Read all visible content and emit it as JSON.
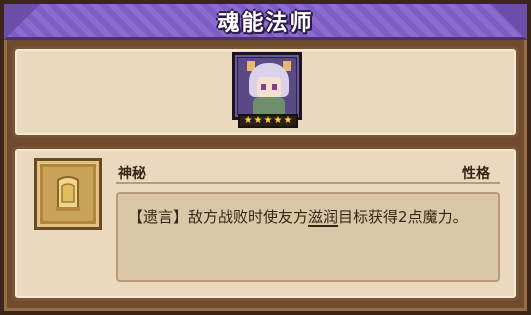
{
  "card": {
    "title": "魂能法师",
    "portrait_icon": "character-portrait-silver-hair-mage",
    "star_count": 5,
    "stars": [
      "★",
      "★",
      "★",
      "★",
      "★"
    ]
  },
  "trait": {
    "name": "神秘",
    "type_label": "性格",
    "icon": "golden-tablet-icon",
    "description_prefix": "【遗言】敌方战败时使友方",
    "description_keyword": "滋润",
    "description_suffix": "目标获得2点魔力。"
  },
  "colors": {
    "header": "#8c6cd0",
    "panel": "#ead8bf",
    "frame": "#6e4a2f",
    "star": "#ffd23a"
  }
}
